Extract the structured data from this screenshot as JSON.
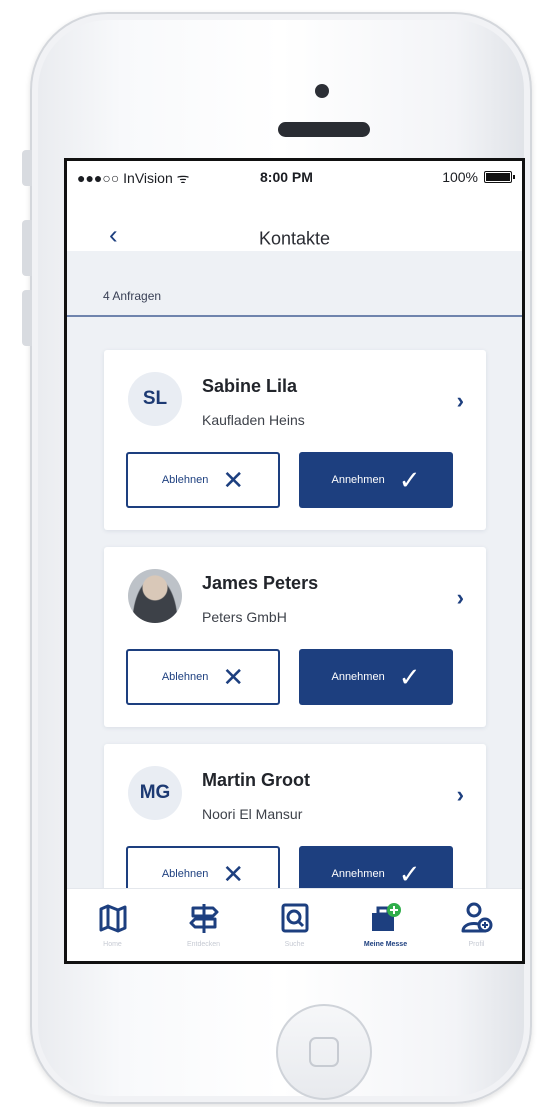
{
  "status_bar": {
    "carrier": "●●●○○ InVision ᯤ",
    "time": "8:00 PM",
    "battery": "100%"
  },
  "nav": {
    "back_icon": "‹",
    "title": "Kontakte"
  },
  "section": {
    "label": "4 Anfragen"
  },
  "contacts": [
    {
      "initials": "SL",
      "name": "Sabine Lila",
      "company": "Kaufladen Heins",
      "reject": "Ablehnen",
      "accept": "Annehmen"
    },
    {
      "initials": "",
      "name": "James Peters",
      "company": "Peters GmbH",
      "reject": "Ablehnen",
      "accept": "Annehmen"
    },
    {
      "initials": "MG",
      "name": "Martin Groot",
      "company": "Noori El Mansur",
      "reject": "Ablehnen",
      "accept": "Annehmen"
    }
  ],
  "icons": {
    "chevron": "›",
    "reject": "✕",
    "accept": "✓"
  },
  "tabs": [
    {
      "label": "Home",
      "icon": "map-icon"
    },
    {
      "label": "Entdecken",
      "icon": "signpost-icon"
    },
    {
      "label": "Suche",
      "icon": "search-book-icon"
    },
    {
      "label": "Meine Messe",
      "icon": "briefcase-plus-icon"
    },
    {
      "label": "Profil",
      "icon": "profile-icon"
    }
  ],
  "colors": {
    "primary": "#1d3f7f",
    "background": "#eef1f5",
    "accent_green": "#2fae4a"
  }
}
